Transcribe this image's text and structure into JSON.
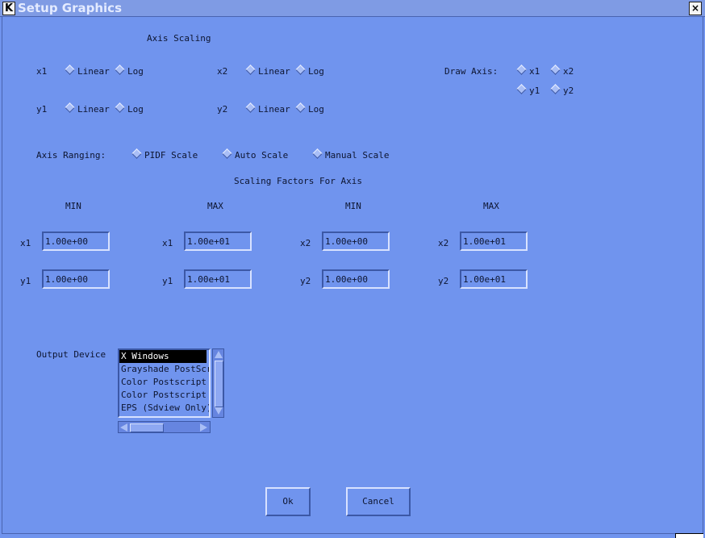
{
  "window": {
    "title": "Setup Graphics",
    "close_icon": "close-icon",
    "app_icon": "k-icon"
  },
  "axis_scaling": {
    "title": "Axis Scaling",
    "x1": {
      "label": "x1",
      "linear": "Linear",
      "log": "Log"
    },
    "x2": {
      "label": "x2",
      "linear": "Linear",
      "log": "Log"
    },
    "y1": {
      "label": "y1",
      "linear": "Linear",
      "log": "Log"
    },
    "y2": {
      "label": "y2",
      "linear": "Linear",
      "log": "Log"
    }
  },
  "draw_axis": {
    "label": "Draw Axis:",
    "x1": "x1",
    "x2": "x2",
    "y1": "y1",
    "y2": "y2"
  },
  "axis_ranging": {
    "label": "Axis Ranging:",
    "pidf": "PIDF Scale",
    "auto": "Auto Scale",
    "manual": "Manual Scale"
  },
  "scaling_factors": {
    "title": "Scaling Factors For Axis",
    "headers": [
      "MIN",
      "MAX",
      "MIN",
      "MAX"
    ],
    "x1_min": {
      "label": "x1",
      "value": "1.00e+00"
    },
    "x1_max": {
      "label": "x1",
      "value": "1.00e+01"
    },
    "x2_min": {
      "label": "x2",
      "value": "1.00e+00"
    },
    "x2_max": {
      "label": "x2",
      "value": "1.00e+01"
    },
    "y1_min": {
      "label": "y1",
      "value": "1.00e+00"
    },
    "y1_max": {
      "label": "y1",
      "value": "1.00e+01"
    },
    "y2_min": {
      "label": "y2",
      "value": "1.00e+00"
    },
    "y2_max": {
      "label": "y2",
      "value": "1.00e+01"
    }
  },
  "output_device": {
    "label": "Output Device",
    "items": [
      "X Windows",
      "Grayshade PostScr:",
      "Color Postscript (",
      "Color Postscript (",
      "EPS (Sdview Only)"
    ],
    "selected_index": 0
  },
  "buttons": {
    "ok": "Ok",
    "cancel": "Cancel"
  },
  "colors": {
    "background": "#7094ee",
    "shadow": "#3c58a6",
    "highlight": "#d8e2ff"
  }
}
